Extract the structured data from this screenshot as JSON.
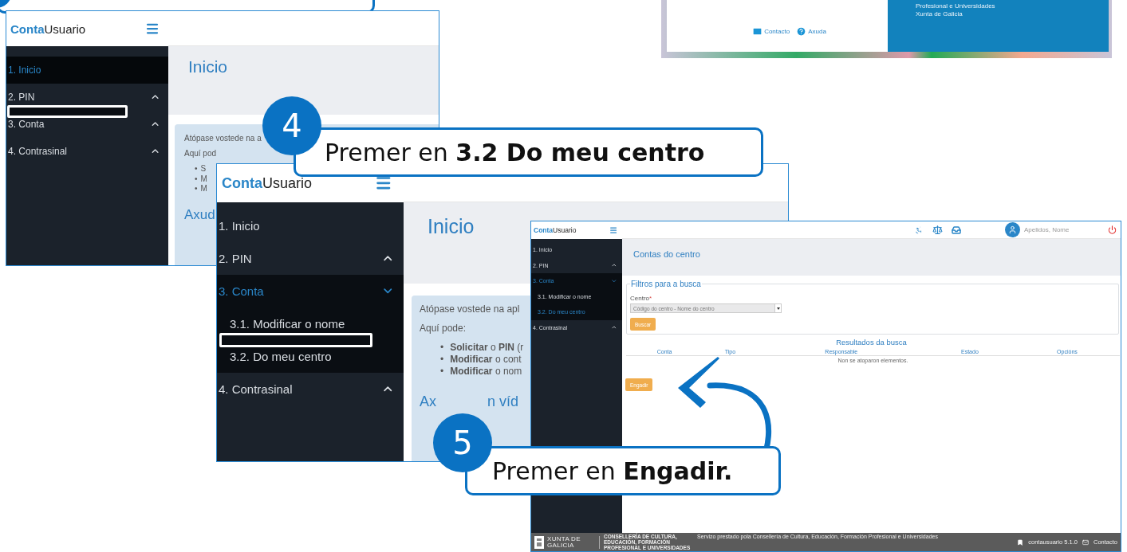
{
  "login_screen": {
    "links": [
      {
        "kind": "mail",
        "label": "Contacto"
      },
      {
        "kind": "help",
        "label": "Axuda"
      }
    ],
    "info_lines": [
      "Profesional e Universidades",
      "Xunta de Galicia"
    ]
  },
  "screens": [
    {
      "kind": "home",
      "brand": {
        "accent": "Conta",
        "rest": "Usuario"
      },
      "menu": [
        {
          "label": "1. Inicio",
          "selected": true
        },
        {
          "label": "2. PIN",
          "selected": false,
          "expanded": false
        },
        {
          "label": "3. Conta",
          "selected": false,
          "expanded": false
        },
        {
          "label": "4. Contrasinal",
          "selected": false,
          "expanded": false
        }
      ],
      "title": "Inicio",
      "card": {
        "intro": "Atópase vostede na a",
        "lead": "Aquí pod",
        "bullets": [
          {
            "marker": "•",
            "text": "S"
          },
          {
            "marker": "•",
            "text": "M"
          },
          {
            "marker": "•",
            "text": "M"
          }
        ],
        "heading": [
          "Axud"
        ]
      }
    },
    {
      "kind": "home",
      "brand": {
        "accent": "Conta",
        "rest": "Usuario"
      },
      "menu": [
        {
          "label": "1. Inicio",
          "selected": false
        },
        {
          "label": "2. PIN",
          "selected": false,
          "expanded": false
        },
        {
          "label": "3. Conta",
          "selected": true,
          "expanded": true,
          "children": [
            {
              "label": "3.1. Modificar o nome",
              "selected": false
            },
            {
              "label": "3.2. Do meu centro",
              "selected": false
            }
          ]
        },
        {
          "label": "4. Contrasinal",
          "selected": false,
          "expanded": false
        }
      ],
      "title": "Inicio",
      "card": {
        "intro": "Atópase vostede na apl",
        "lead": "Aquí pode:",
        "bullets": [
          {
            "marker": "•",
            "text": "**Solicitar** o **PIN** (r"
          },
          {
            "marker": "•",
            "text": "**Modificar** o cont"
          },
          {
            "marker": "•",
            "text": "**Modificar** o nom"
          }
        ],
        "heading": [
          "Ax",
          "n víd"
        ]
      }
    },
    {
      "kind": "accounts",
      "brand": {
        "accent": "Conta",
        "rest": "Usuario"
      },
      "menu": [
        {
          "label": "1. Inicio",
          "selected": false
        },
        {
          "label": "2. PIN",
          "selected": false,
          "expanded": false
        },
        {
          "label": "3. Conta",
          "selected": true,
          "expanded": true,
          "children": [
            {
              "label": "3.1. Modificar o nome",
              "selected": false
            },
            {
              "label": "3.2. Do meu centro",
              "selected": true
            }
          ]
        },
        {
          "label": "4. Contrasinal",
          "selected": false,
          "expanded": false
        }
      ],
      "user": "Apelidos, Nome",
      "title": "Contas do centro",
      "filters": {
        "legend": "Filtros para a busca",
        "field_label": "Centro",
        "required_mark": "*",
        "placeholder": "Código do centro - Nome do centro",
        "button": "Buscar"
      },
      "results": {
        "title": "Resultados da busca",
        "columns": [
          "Conta",
          "Tipo",
          "Responsable",
          "Estado",
          "Opcións"
        ],
        "empty": "Non se atoparon elementos."
      },
      "add_button": "Engadir",
      "footer": {
        "logo": "XUNTA DE GALICIA",
        "department": "CONSELLERÍA DE CULTURA, EDUCACIÓN, FORMACIÓN PROFESIONAL E UNIVERSIDADES",
        "service": "Servizo prestado pola Consellería de Cultura, Educación, Formación Profesional e Universidades",
        "version": "contausuario 5.1.0",
        "contact": "Contacto"
      }
    }
  ],
  "callouts": [
    {
      "number": "4",
      "text": "Premer en **3.2 Do meu centro**"
    },
    {
      "number": "5",
      "text": "Premer en **Engadir.**"
    }
  ]
}
